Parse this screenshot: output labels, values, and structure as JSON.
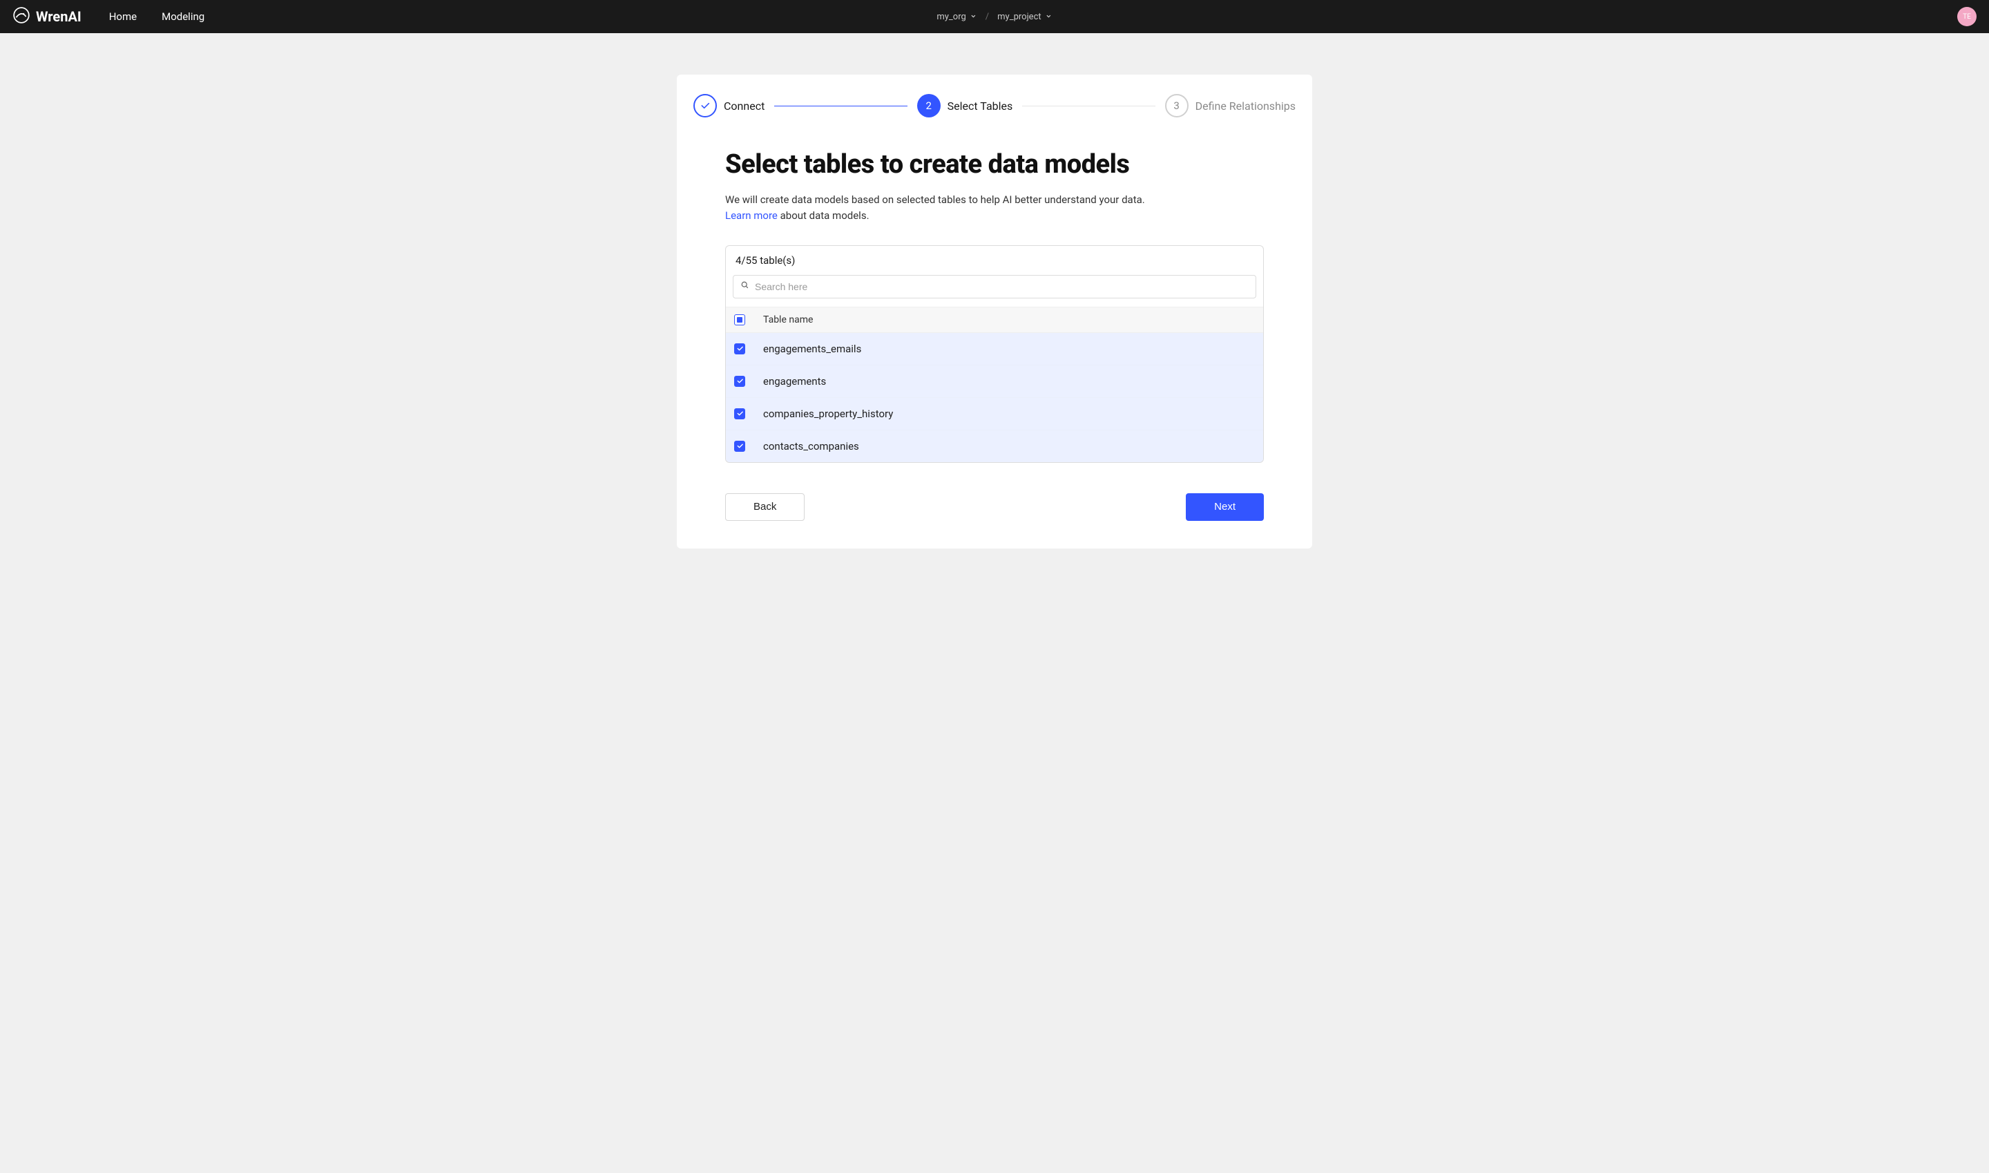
{
  "brand": {
    "name": "WrenAI"
  },
  "nav": {
    "home": "Home",
    "modeling": "Modeling"
  },
  "breadcrumb": {
    "org": "my_org",
    "project": "my_project"
  },
  "avatar": {
    "initials": "TE"
  },
  "steps": {
    "step1": {
      "label": "Connect"
    },
    "step2": {
      "index": "2",
      "label": "Select Tables"
    },
    "step3": {
      "index": "3",
      "label": "Define Relationships"
    }
  },
  "content": {
    "title": "Select tables to create data models",
    "subtitle_pre": "We will create data models based on selected tables to help AI better understand your data.",
    "learn_more": "Learn more",
    "subtitle_post": " about data models."
  },
  "selector": {
    "count_label": "4/55 table(s)",
    "search_placeholder": "Search here",
    "column_header": "Table name",
    "rows": [
      {
        "name": "engagements_emails",
        "checked": true
      },
      {
        "name": "engagements",
        "checked": true
      },
      {
        "name": "companies_property_history",
        "checked": true
      },
      {
        "name": "contacts_companies",
        "checked": true
      }
    ]
  },
  "buttons": {
    "back": "Back",
    "next": "Next"
  }
}
